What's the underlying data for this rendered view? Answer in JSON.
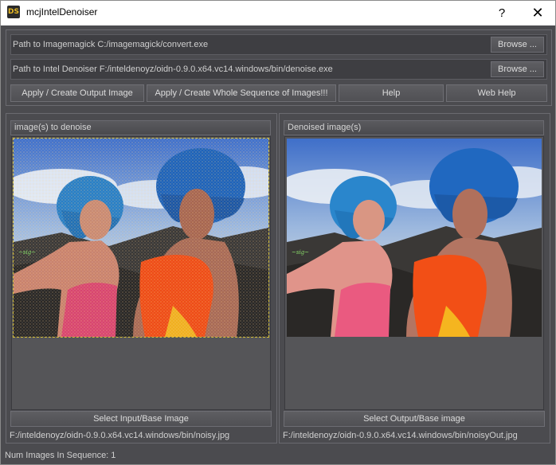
{
  "window": {
    "app_icon": "DS",
    "title": "mcjIntelDenoiser",
    "help_glyph": "?",
    "close_glyph": "✕"
  },
  "paths": {
    "imagemagick_label": "Path to Imagemagick  C:/imagemagick/convert.exe",
    "denoiser_label": "Path to Intel Denoiser F:/inteldenoyz/oidn-0.9.0.x64.vc14.windows/bin/denoise.exe",
    "browse_label": "Browse ..."
  },
  "actions": {
    "apply_output": "Apply / Create Output Image",
    "apply_sequence": "Apply / Create Whole Sequence of Images!!!",
    "help": "Help",
    "web_help": "Web Help"
  },
  "input_panel": {
    "header": "image(s) to denoise",
    "select_button": "Select Input/Base Image",
    "path": "F:/inteldenoyz/oidn-0.9.0.x64.vc14.windows/bin/noisy.jpg"
  },
  "output_panel": {
    "header": "Denoised image(s)",
    "select_button": "Select Output/Base image",
    "path": "F:/inteldenoyz/oidn-0.9.0.x64.vc14.windows/bin/noisyOut.jpg"
  },
  "status": {
    "sequence_count": "Num Images In Sequence: 1"
  },
  "colors": {
    "background": "#4b4b4f",
    "button": "#58585c",
    "text": "#d0d0d0",
    "selection_dash": "#d8c23a"
  }
}
